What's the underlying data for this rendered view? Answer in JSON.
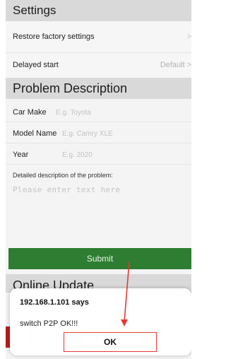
{
  "settings": {
    "title": "Settings",
    "restore_label": "Restore factory settings",
    "restore_chevron": ">",
    "delayed_label": "Delayed start",
    "delayed_value": "Default",
    "delayed_chevron": ">"
  },
  "problem": {
    "title": "Problem Description",
    "fields": [
      {
        "label": "Car Make",
        "placeholder": "E.g. Toyota"
      },
      {
        "label": "Model Name",
        "placeholder": "E.g. Camry XLE"
      },
      {
        "label": "Year",
        "placeholder": "E.g. 2020"
      }
    ],
    "description_label": "Detailed description of the problem:",
    "description_placeholder": "Please enter text here",
    "submit_label": "Submit"
  },
  "update": {
    "title": "Online Update"
  },
  "dialog": {
    "title": "192.168.1.101 says",
    "message": "switch P2P OK!!!",
    "ok_label": "OK"
  },
  "colors": {
    "submit_bg": "#2e7d32",
    "annotation_red": "#e53935",
    "header_bg": "#d9d9d9"
  }
}
